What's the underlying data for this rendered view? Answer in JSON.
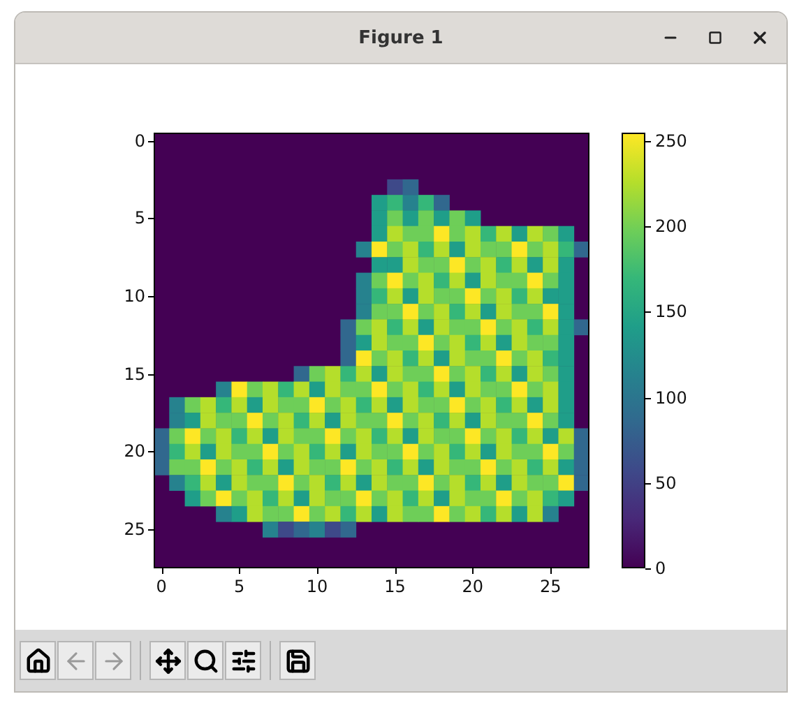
{
  "window": {
    "title": "Figure 1"
  },
  "plot": {
    "kind": "picture",
    "x_ticks": [
      "0",
      "5",
      "10",
      "15",
      "20",
      "25"
    ],
    "y_ticks": [
      "0",
      "5",
      "10",
      "15",
      "20",
      "25"
    ],
    "colorbar_ticks": [
      "250",
      "200",
      "150",
      "100",
      "50",
      "0"
    ]
  },
  "toolbar": {
    "buttons": [
      {
        "kind": "home",
        "disabled": false
      },
      {
        "kind": "back",
        "disabled": true
      },
      {
        "kind": "forward",
        "disabled": true
      },
      {
        "kind": "pan",
        "disabled": false
      },
      {
        "kind": "zoom",
        "disabled": false
      },
      {
        "kind": "configure",
        "disabled": false
      },
      {
        "kind": "save",
        "disabled": false
      }
    ]
  }
}
